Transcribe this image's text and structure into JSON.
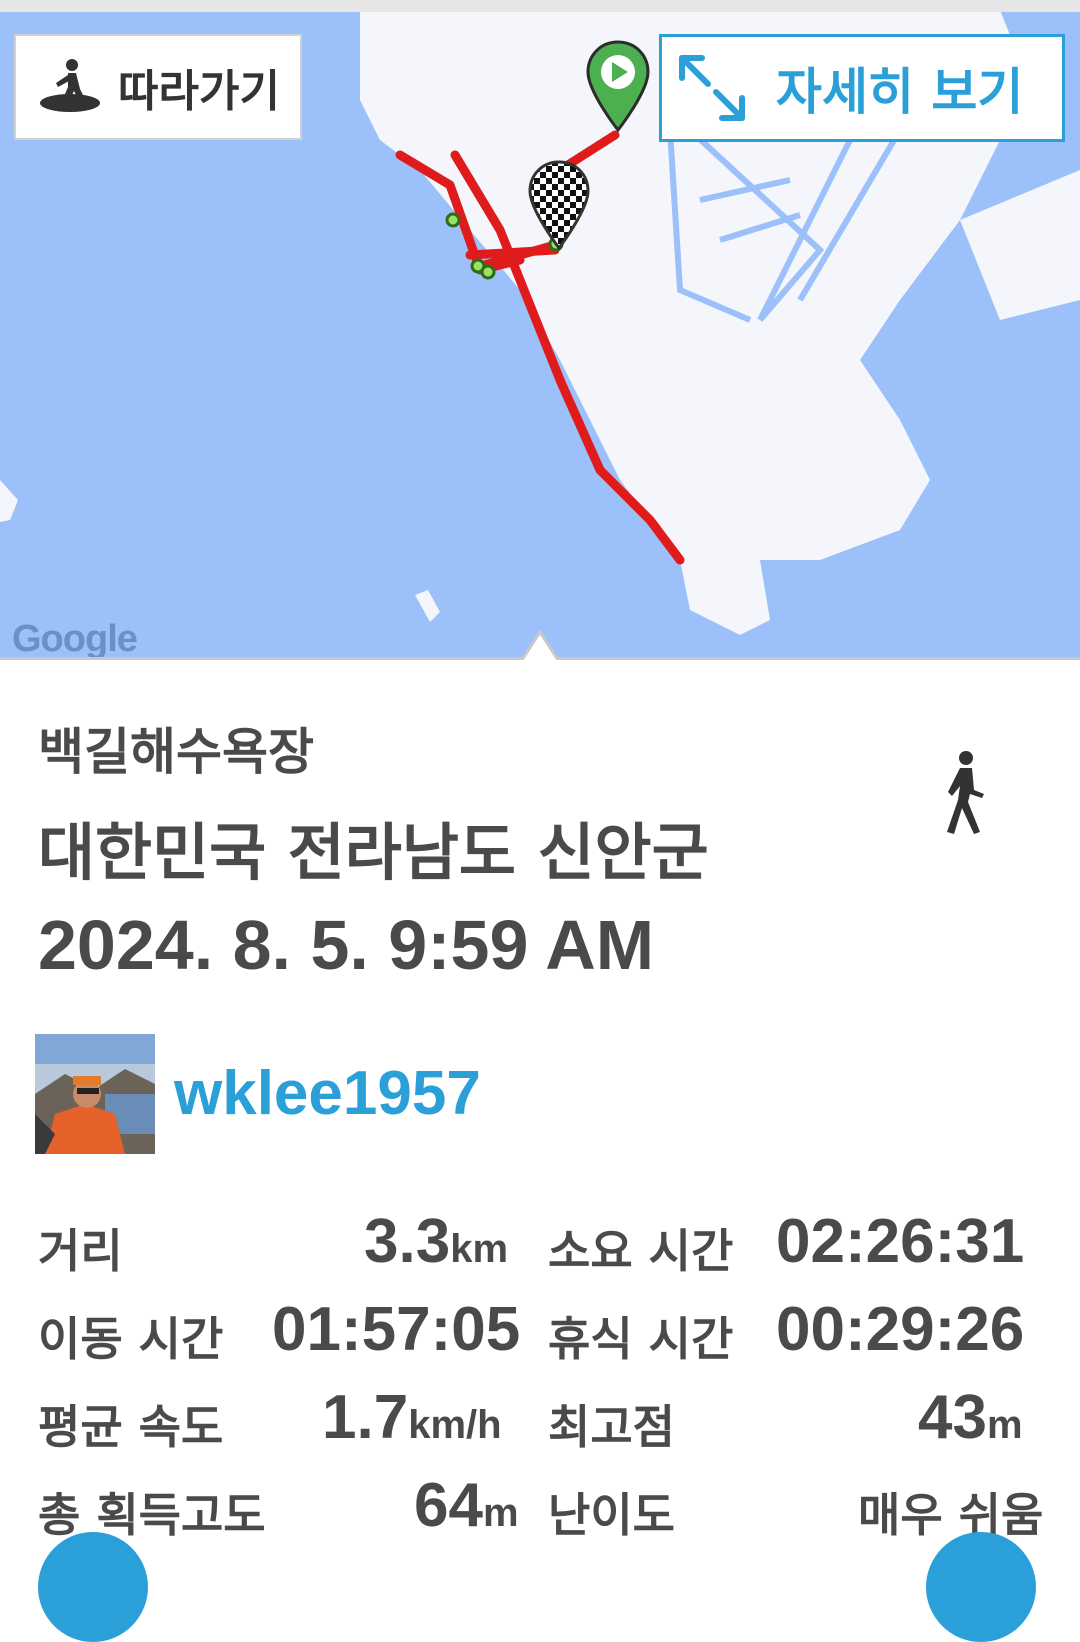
{
  "map": {
    "follow_label": "따라가기",
    "detail_label": "자세히 보기",
    "google_label": "Google",
    "colors": {
      "water": "#9cc0f9",
      "land": "#f4f6fb",
      "route": "#e01b1b",
      "accent": "#2a9fd8"
    },
    "icons": [
      "hiker-icon",
      "expand-arrows-icon",
      "start-marker-icon",
      "finish-flag-icon",
      "waypoint-icon"
    ]
  },
  "trip": {
    "place": "백길해수욕장",
    "region": "대한민국 전라남도 신안군",
    "datetime": "2024. 8. 5. 9:59 AM",
    "activity_icon": "walking-icon"
  },
  "user": {
    "name": "wklee1957",
    "avatar": "profile-photo"
  },
  "stats": {
    "distance": {
      "label": "거리",
      "value": "3.3",
      "unit": "km"
    },
    "total_time": {
      "label": "소요 시간",
      "value": "02:26:31"
    },
    "moving_time": {
      "label": "이동 시간",
      "value": "01:57:05"
    },
    "rest_time": {
      "label": "휴식 시간",
      "value": "00:29:26"
    },
    "avg_speed": {
      "label": "평균 속도",
      "value": "1.7",
      "unit": "km/h"
    },
    "max_elevation": {
      "label": "최고점",
      "value": "43",
      "unit": "m"
    },
    "elevation_gain": {
      "label": "총 획득고도",
      "value": "64",
      "unit": "m"
    },
    "difficulty": {
      "label": "난이도",
      "value": "매우 쉬움"
    }
  }
}
